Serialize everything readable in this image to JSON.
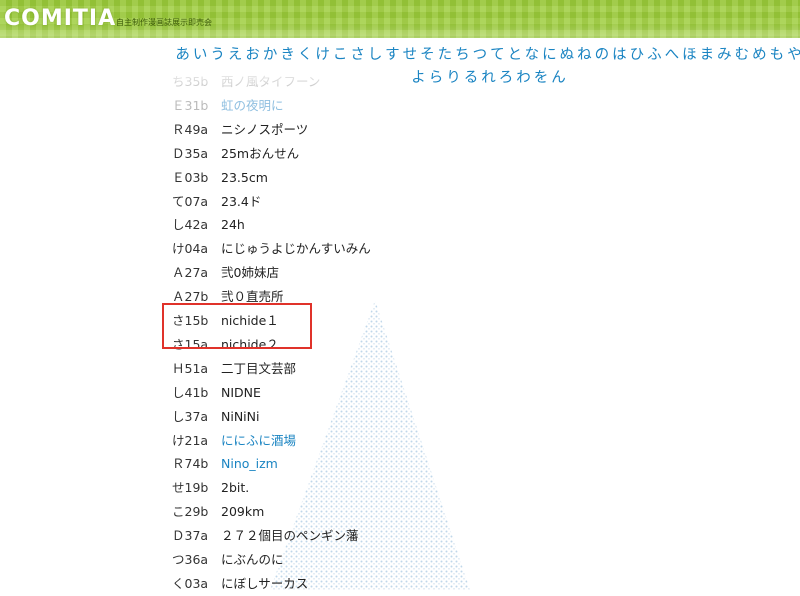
{
  "header": {
    "logo": "COMITIA",
    "tagline": "自主制作漫画誌展示即売会",
    "bg_color": "#9ccc3a"
  },
  "kana_index": {
    "line1": [
      "あ",
      "い",
      "う",
      "え",
      "お",
      "か",
      "き",
      "く",
      "け",
      "こ",
      "さ",
      "し",
      "す",
      "せ",
      "そ",
      "た",
      "ち",
      "つ",
      "て",
      "と",
      "な",
      "に",
      "ぬ",
      "ね",
      "の",
      "は",
      "ひ",
      "ふ",
      "へ",
      "ほ",
      "ま",
      "み",
      "む",
      "め",
      "も",
      "や"
    ],
    "line2": [
      "よ",
      "ら",
      "り",
      "る",
      "れ",
      "ろ",
      "わ",
      "を",
      "ん"
    ],
    "color": "#1a84c2"
  },
  "circles": [
    {
      "code": "ち35b",
      "name": "西ノ風タイフーン",
      "link": false
    },
    {
      "code": "Ｅ31b",
      "name": "虹の夜明に",
      "link": true
    },
    {
      "code": "Ｒ49a",
      "name": "ニシノスポーツ",
      "link": false
    },
    {
      "code": "Ｄ35a",
      "name": "25mおんせん",
      "link": false
    },
    {
      "code": "Ｅ03b",
      "name": "23.5cm",
      "link": false
    },
    {
      "code": "て07a",
      "name": "23.4ド",
      "link": false
    },
    {
      "code": "し42a",
      "name": "24h",
      "link": false
    },
    {
      "code": "け04a",
      "name": "にじゅうよじかんすいみん",
      "link": false
    },
    {
      "code": "Ａ27a",
      "name": "弐0姉妹店",
      "link": false
    },
    {
      "code": "Ａ27b",
      "name": "弐０直売所",
      "link": false
    },
    {
      "code": "さ15b",
      "name": "nichide１",
      "link": false
    },
    {
      "code": "さ15a",
      "name": "nichide２",
      "link": false
    },
    {
      "code": "Ｈ51a",
      "name": "二丁目文芸部",
      "link": false
    },
    {
      "code": "し41b",
      "name": "NIDNE",
      "link": false
    },
    {
      "code": "し37a",
      "name": "NiNiNi",
      "link": false
    },
    {
      "code": "け21a",
      "name": "ににふに酒場",
      "link": true
    },
    {
      "code": "Ｒ74b",
      "name": "Nino_izm",
      "link": true
    },
    {
      "code": "せ19b",
      "name": "2bit.",
      "link": false
    },
    {
      "code": "こ29b",
      "name": "209km",
      "link": false
    },
    {
      "code": "Ｄ37a",
      "name": "２７２個目のペンギン藩",
      "link": false
    },
    {
      "code": "つ36a",
      "name": "にぶんのに",
      "link": false
    },
    {
      "code": "く03a",
      "name": "にぼしサーカス",
      "link": false
    }
  ],
  "highlight_color": "#e0322a"
}
